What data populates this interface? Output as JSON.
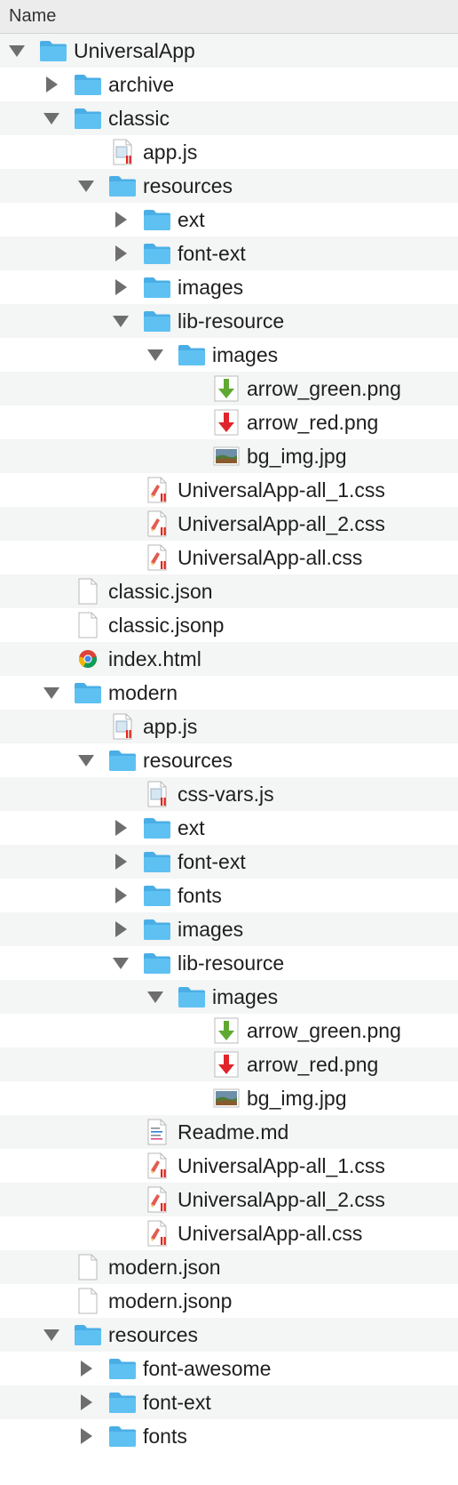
{
  "header": {
    "name_column": "Name"
  },
  "colors": {
    "folder_body": "#5ec1f2",
    "folder_tab": "#4aaee6",
    "stripe": "#f4f5f5",
    "disclosure": "#6e6e6e"
  },
  "items": [
    {
      "label": "UniversalApp",
      "depth": 0,
      "kind": "folder",
      "state": "expanded",
      "icon": "folder-icon"
    },
    {
      "label": "archive",
      "depth": 1,
      "kind": "folder",
      "state": "collapsed",
      "icon": "folder-icon"
    },
    {
      "label": "classic",
      "depth": 1,
      "kind": "folder",
      "state": "expanded",
      "icon": "folder-icon"
    },
    {
      "label": "app.js",
      "depth": 2,
      "kind": "file",
      "icon": "js-file-icon"
    },
    {
      "label": "resources",
      "depth": 2,
      "kind": "folder",
      "state": "expanded",
      "icon": "folder-icon"
    },
    {
      "label": "ext",
      "depth": 3,
      "kind": "folder",
      "state": "collapsed",
      "icon": "folder-icon"
    },
    {
      "label": "font-ext",
      "depth": 3,
      "kind": "folder",
      "state": "collapsed",
      "icon": "folder-icon"
    },
    {
      "label": "images",
      "depth": 3,
      "kind": "folder",
      "state": "collapsed",
      "icon": "folder-icon"
    },
    {
      "label": "lib-resource",
      "depth": 3,
      "kind": "folder",
      "state": "expanded",
      "icon": "folder-icon"
    },
    {
      "label": "images",
      "depth": 4,
      "kind": "folder",
      "state": "expanded",
      "icon": "folder-icon"
    },
    {
      "label": "arrow_green.png",
      "depth": 5,
      "kind": "file",
      "icon": "green-arrow-image-icon"
    },
    {
      "label": "arrow_red.png",
      "depth": 5,
      "kind": "file",
      "icon": "red-arrow-image-icon"
    },
    {
      "label": "bg_img.jpg",
      "depth": 5,
      "kind": "file",
      "icon": "photo-thumbnail-icon"
    },
    {
      "label": "UniversalApp-all_1.css",
      "depth": 3,
      "kind": "file",
      "icon": "css-file-icon"
    },
    {
      "label": "UniversalApp-all_2.css",
      "depth": 3,
      "kind": "file",
      "icon": "css-file-icon"
    },
    {
      "label": "UniversalApp-all.css",
      "depth": 3,
      "kind": "file",
      "icon": "css-file-icon"
    },
    {
      "label": "classic.json",
      "depth": 1,
      "kind": "file",
      "icon": "blank-document-icon"
    },
    {
      "label": "classic.jsonp",
      "depth": 1,
      "kind": "file",
      "icon": "blank-document-icon"
    },
    {
      "label": "index.html",
      "depth": 1,
      "kind": "file",
      "icon": "chrome-html-icon"
    },
    {
      "label": "modern",
      "depth": 1,
      "kind": "folder",
      "state": "expanded",
      "icon": "folder-icon"
    },
    {
      "label": "app.js",
      "depth": 2,
      "kind": "file",
      "icon": "js-file-icon"
    },
    {
      "label": "resources",
      "depth": 2,
      "kind": "folder",
      "state": "expanded",
      "icon": "folder-icon"
    },
    {
      "label": "css-vars.js",
      "depth": 3,
      "kind": "file",
      "icon": "js-file-icon"
    },
    {
      "label": "ext",
      "depth": 3,
      "kind": "folder",
      "state": "collapsed",
      "icon": "folder-icon"
    },
    {
      "label": "font-ext",
      "depth": 3,
      "kind": "folder",
      "state": "collapsed",
      "icon": "folder-icon"
    },
    {
      "label": "fonts",
      "depth": 3,
      "kind": "folder",
      "state": "collapsed",
      "icon": "folder-icon"
    },
    {
      "label": "images",
      "depth": 3,
      "kind": "folder",
      "state": "collapsed",
      "icon": "folder-icon"
    },
    {
      "label": "lib-resource",
      "depth": 3,
      "kind": "folder",
      "state": "expanded",
      "icon": "folder-icon"
    },
    {
      "label": "images",
      "depth": 4,
      "kind": "folder",
      "state": "expanded",
      "icon": "folder-icon"
    },
    {
      "label": "arrow_green.png",
      "depth": 5,
      "kind": "file",
      "icon": "green-arrow-image-icon"
    },
    {
      "label": "arrow_red.png",
      "depth": 5,
      "kind": "file",
      "icon": "red-arrow-image-icon"
    },
    {
      "label": "bg_img.jpg",
      "depth": 5,
      "kind": "file",
      "icon": "photo-thumbnail-icon"
    },
    {
      "label": "Readme.md",
      "depth": 3,
      "kind": "file",
      "icon": "text-document-icon"
    },
    {
      "label": "UniversalApp-all_1.css",
      "depth": 3,
      "kind": "file",
      "icon": "css-file-icon"
    },
    {
      "label": "UniversalApp-all_2.css",
      "depth": 3,
      "kind": "file",
      "icon": "css-file-icon"
    },
    {
      "label": "UniversalApp-all.css",
      "depth": 3,
      "kind": "file",
      "icon": "css-file-icon"
    },
    {
      "label": "modern.json",
      "depth": 1,
      "kind": "file",
      "icon": "blank-document-icon"
    },
    {
      "label": "modern.jsonp",
      "depth": 1,
      "kind": "file",
      "icon": "blank-document-icon"
    },
    {
      "label": "resources",
      "depth": 1,
      "kind": "folder",
      "state": "expanded",
      "icon": "folder-icon"
    },
    {
      "label": "font-awesome",
      "depth": 2,
      "kind": "folder",
      "state": "collapsed",
      "icon": "folder-icon"
    },
    {
      "label": "font-ext",
      "depth": 2,
      "kind": "folder",
      "state": "collapsed",
      "icon": "folder-icon"
    },
    {
      "label": "fonts",
      "depth": 2,
      "kind": "folder",
      "state": "collapsed",
      "icon": "folder-icon"
    }
  ]
}
